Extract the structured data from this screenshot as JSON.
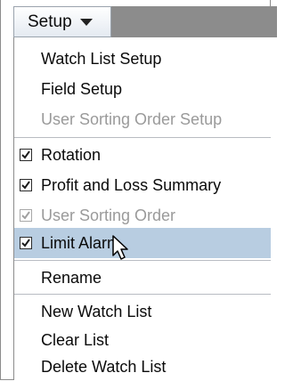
{
  "menubar": {
    "setup_label": "Setup"
  },
  "menu": {
    "items": [
      {
        "label": "Watch List Setup",
        "enabled": true
      },
      {
        "label": "Field Setup",
        "enabled": true
      },
      {
        "label": "User Sorting Order Setup",
        "enabled": false
      },
      {
        "label": "Rotation",
        "checked": true,
        "enabled": true
      },
      {
        "label": "Profit and Loss Summary",
        "checked": true,
        "enabled": true
      },
      {
        "label": "User Sorting Order",
        "checked": true,
        "enabled": false
      },
      {
        "label": "Limit Alarm",
        "checked": true,
        "enabled": true,
        "highlighted": true
      },
      {
        "label": "Rename",
        "enabled": true
      },
      {
        "label": "New Watch List",
        "enabled": true
      },
      {
        "label": "Clear List",
        "enabled": true
      },
      {
        "label": "Delete Watch List",
        "enabled": true
      }
    ]
  },
  "colors": {
    "highlight": "#b8cde1",
    "disabled_text": "#9a9a9a",
    "bar_fill": "#8c8c8c"
  },
  "icons": {
    "dropdown": "chevron-down-icon",
    "cursor": "mouse-pointer-icon"
  }
}
